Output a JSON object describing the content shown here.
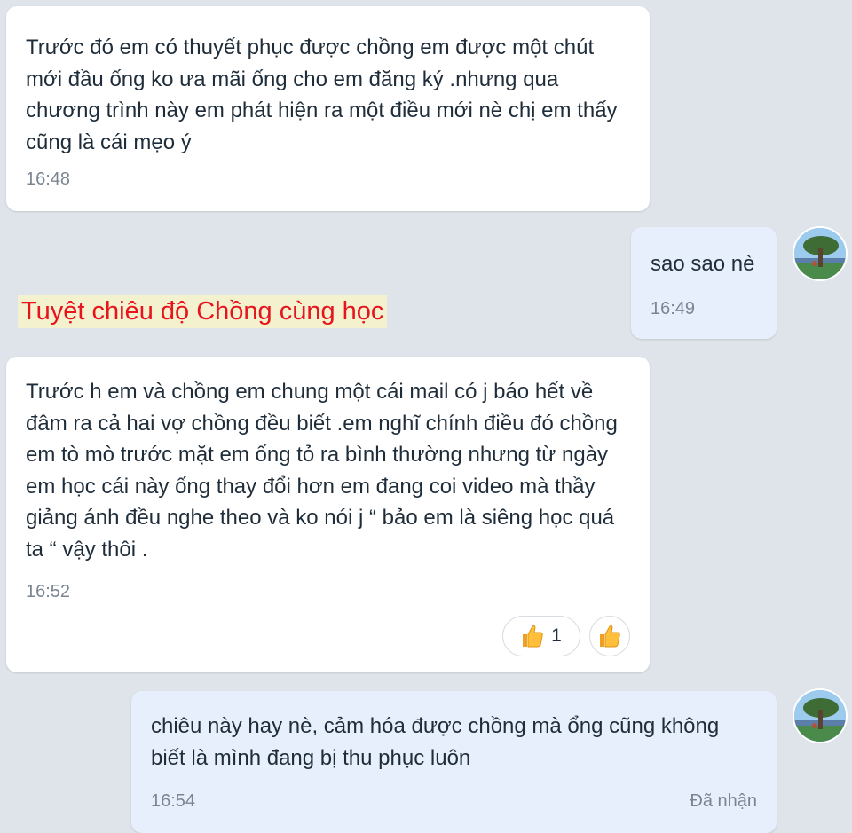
{
  "messages": [
    {
      "text": "Trước đó em có thuyết phục được chồng em được một chút mới đầu ống ko ưa mãi ống cho em đăng ký .nhưng qua chương trình này em phát hiện ra một điều mới nè chị em thấy cũng là cái mẹo ý",
      "time": "16:48"
    },
    {
      "text": "sao sao nè",
      "time": "16:49"
    },
    {
      "text": "Trước h em và chồng em chung một cái mail có j báo hết về đâm ra cả hai vợ chồng đều biết .em nghĩ chính điều đó chồng em tò mò trước mặt em ống tỏ ra bình thường nhưng từ ngày em học cái này ống thay đổi hơn em đang coi video mà thầy giảng ánh đều nghe theo và ko nói j “ bảo em là siêng học quá ta “ vậy thôi .",
      "time": "16:52",
      "reaction_count": "1"
    },
    {
      "text": "chiêu này hay nè, cảm hóa được chồng mà ổng cũng không biết là mình đang bị thu phục luôn",
      "time": "16:54",
      "status": "Đã nhận"
    }
  ],
  "caption": "Tuyệt chiêu độ Chồng cùng học",
  "icons": {
    "reaction": "thumbs-up-icon",
    "avatar": "user-avatar-tree-photo"
  },
  "colors": {
    "background": "#dfe4ea",
    "incoming": "#ffffff",
    "outgoing": "#e7effc",
    "caption_text": "#e8141d",
    "caption_bg": "#f4f1cf"
  }
}
